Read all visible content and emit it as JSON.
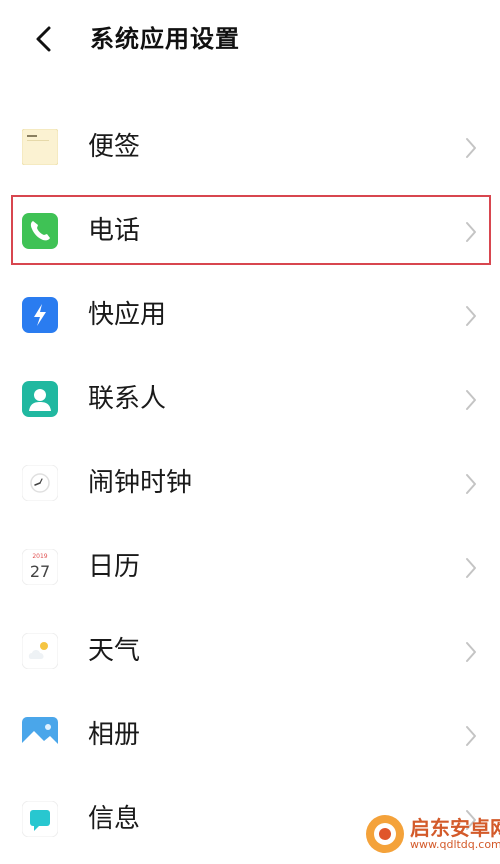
{
  "header": {
    "title": "系统应用设置",
    "back_icon": "back-chevron-icon"
  },
  "list": {
    "items": [
      {
        "label": "便签",
        "icon": "notes-icon"
      },
      {
        "label": "电话",
        "icon": "phone-icon",
        "highlighted": true
      },
      {
        "label": "快应用",
        "icon": "quick-app-icon"
      },
      {
        "label": "联系人",
        "icon": "contacts-icon"
      },
      {
        "label": "闹钟时钟",
        "icon": "clock-icon"
      },
      {
        "label": "日历",
        "icon": "calendar-icon",
        "icon_text": "27",
        "icon_small_text": "2019"
      },
      {
        "label": "天气",
        "icon": "weather-icon"
      },
      {
        "label": "相册",
        "icon": "gallery-icon"
      },
      {
        "label": "信息",
        "icon": "messages-icon"
      }
    ]
  },
  "watermark": {
    "brand": "启东安卓网",
    "url": "www.qdltdq.com"
  },
  "colors": {
    "highlight_border": "#d8464f",
    "phone_green": "#3fc255",
    "quick_blue": "#2a7cf0",
    "contacts_teal": "#20b8a0",
    "gallery_blue": "#4aa6ea",
    "messages_cyan": "#28c7d0",
    "chevron_gray": "#c4c4c4",
    "watermark_orange": "#d35a2a"
  }
}
